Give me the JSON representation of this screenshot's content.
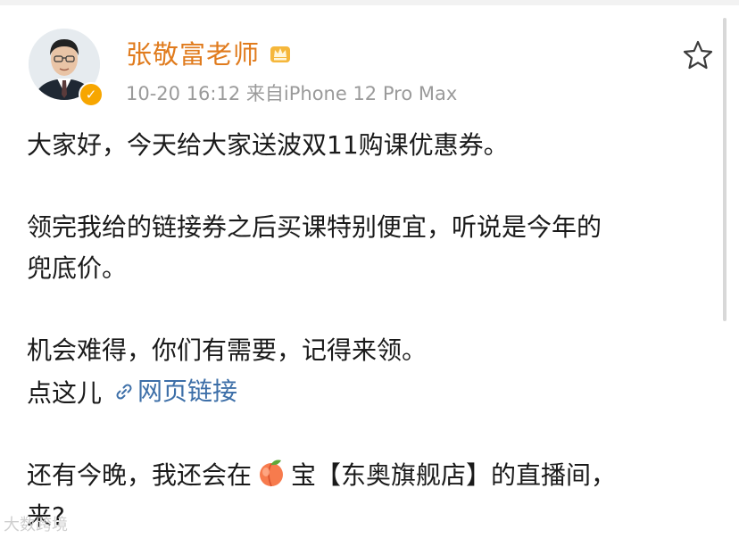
{
  "post": {
    "author": "张敬富老师",
    "meta": "10-20 16:12  来自iPhone 12 Pro Max",
    "body": {
      "line1": "大家好，今天给大家送波双11购课优惠券。",
      "line2": "领完我给的链接券之后买课特别便宜，听说是今年的",
      "line3": "兜底价。",
      "line4": "机会难得，你们有需要，记得来领。",
      "line5_prefix": "点这儿",
      "link_text": "网页链接",
      "line6_before_emoji": "还有今晚，我还会在",
      "line6_after_emoji": "宝【东奥旗舰店】的直播间，",
      "line7": "来?"
    }
  },
  "watermark": "大数跨境",
  "icons": {
    "favorite": "star-outline-icon",
    "member_badge": "crown-icon",
    "verified_badge": "verified-icon",
    "link": "link-icon",
    "emoji": "peach-emoji-icon"
  },
  "colors": {
    "author": "#e07b1d",
    "link": "#3d6fa8",
    "meta": "#9a9a9a",
    "verified": "#f7a600"
  }
}
